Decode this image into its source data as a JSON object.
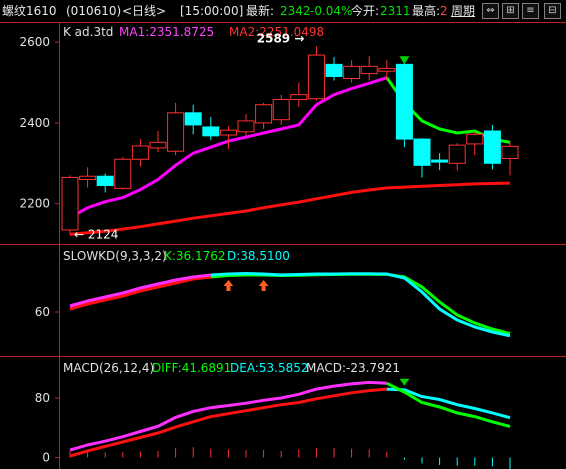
{
  "header": {
    "instrument": "螺纹1610",
    "code": "(010610)",
    "period": "<日线>",
    "time": "[15:00:00]",
    "latest_label": "最新:",
    "latest_value": "2342",
    "change_pct": "-0.04%",
    "open_label": "今开:",
    "open_value": "2311",
    "high_label": "最高:",
    "high_value": "2",
    "cycle_link": "周期",
    "buttons": [
      "⇔",
      "⊞",
      "≡",
      "⊟"
    ]
  },
  "colors": {
    "up": "#ff3030",
    "down": "#00ffff",
    "ma1_up": "#ff00ff",
    "ma1_down": "#00ff00",
    "ma2": "#ff1010",
    "k": "#ff30ff",
    "d": "#ff1010",
    "k_down": "#00ffff",
    "d_down": "#00ff00",
    "macd_bar": "#ff3030",
    "macd_bar_neg": "#00ffff",
    "axis": "#c02020"
  },
  "chart_data": [
    {
      "type": "candlestick",
      "title": "K  ad.3td",
      "legend": [
        {
          "name": "MA1",
          "label": "MA1:2351.8725"
        },
        {
          "name": "MA2",
          "label": "MA2:2251.0498"
        }
      ],
      "ylim": [
        2120,
        2640
      ],
      "yticks": [
        2200,
        2400,
        2600
      ],
      "annotations": [
        {
          "label": "2589",
          "value": 2589
        },
        {
          "label": "2124",
          "value": 2124
        }
      ],
      "candles": [
        {
          "o": 2135,
          "h": 2270,
          "l": 2124,
          "c": 2265
        },
        {
          "o": 2260,
          "h": 2290,
          "l": 2240,
          "c": 2268
        },
        {
          "o": 2268,
          "h": 2275,
          "l": 2228,
          "c": 2245
        },
        {
          "o": 2238,
          "h": 2315,
          "l": 2235,
          "c": 2310
        },
        {
          "o": 2310,
          "h": 2360,
          "l": 2292,
          "c": 2343
        },
        {
          "o": 2338,
          "h": 2380,
          "l": 2328,
          "c": 2352
        },
        {
          "o": 2330,
          "h": 2450,
          "l": 2320,
          "c": 2425
        },
        {
          "o": 2425,
          "h": 2445,
          "l": 2372,
          "c": 2395
        },
        {
          "o": 2390,
          "h": 2415,
          "l": 2357,
          "c": 2368
        },
        {
          "o": 2370,
          "h": 2392,
          "l": 2335,
          "c": 2382
        },
        {
          "o": 2378,
          "h": 2422,
          "l": 2368,
          "c": 2405
        },
        {
          "o": 2400,
          "h": 2450,
          "l": 2385,
          "c": 2445
        },
        {
          "o": 2408,
          "h": 2470,
          "l": 2395,
          "c": 2458
        },
        {
          "o": 2458,
          "h": 2500,
          "l": 2440,
          "c": 2470
        },
        {
          "o": 2460,
          "h": 2590,
          "l": 2455,
          "c": 2568
        },
        {
          "o": 2545,
          "h": 2563,
          "l": 2505,
          "c": 2515
        },
        {
          "o": 2510,
          "h": 2555,
          "l": 2500,
          "c": 2540
        },
        {
          "o": 2522,
          "h": 2565,
          "l": 2505,
          "c": 2540
        },
        {
          "o": 2528,
          "h": 2555,
          "l": 2505,
          "c": 2535
        },
        {
          "o": 2545,
          "h": 2555,
          "l": 2340,
          "c": 2360
        },
        {
          "o": 2360,
          "h": 2362,
          "l": 2265,
          "c": 2295
        },
        {
          "o": 2308,
          "h": 2325,
          "l": 2283,
          "c": 2303
        },
        {
          "o": 2300,
          "h": 2350,
          "l": 2282,
          "c": 2345
        },
        {
          "o": 2348,
          "h": 2378,
          "l": 2320,
          "c": 2372
        },
        {
          "o": 2380,
          "h": 2395,
          "l": 2285,
          "c": 2300
        },
        {
          "o": 2312,
          "h": 2352,
          "l": 2270,
          "c": 2342
        }
      ],
      "ma1": [
        2165,
        2190,
        2205,
        2215,
        2235,
        2260,
        2295,
        2325,
        2340,
        2355,
        2365,
        2375,
        2385,
        2395,
        2445,
        2470,
        2485,
        2498,
        2512,
        2450,
        2405,
        2385,
        2375,
        2380,
        2360,
        2352
      ],
      "ma2": [
        2124,
        2128,
        2132,
        2137,
        2143,
        2150,
        2157,
        2164,
        2170,
        2176,
        2182,
        2190,
        2197,
        2204,
        2212,
        2220,
        2228,
        2234,
        2239,
        2241,
        2243,
        2245,
        2247,
        2249,
        2250,
        2251
      ],
      "ma1_down_from": 18
    },
    {
      "type": "line",
      "title": "SLOWKD(9,3,3,2)",
      "legend": [
        {
          "name": "K",
          "label": "K:36.1762"
        },
        {
          "name": "D",
          "label": "D:38.5100"
        }
      ],
      "ylim": [
        20,
        110
      ],
      "yticks": [
        60
      ],
      "k": [
        66,
        71,
        75,
        79,
        84,
        88,
        92,
        95,
        97,
        98,
        98.5,
        98,
        97,
        97.5,
        98,
        98,
        98.3,
        98.2,
        98,
        94,
        80,
        63,
        52,
        45,
        40,
        36.2
      ],
      "d": [
        63,
        68,
        72,
        76,
        81,
        85,
        89,
        93,
        95,
        96.5,
        97,
        97,
        96.5,
        96.8,
        97.2,
        97.5,
        97.7,
        97.8,
        97.6,
        95,
        85,
        70,
        57,
        49,
        43,
        38.5
      ],
      "down_from": 8,
      "arrow_marks": [
        9,
        11
      ]
    },
    {
      "type": "line",
      "title": "MACD(26,12,4)",
      "legend": [
        {
          "name": "DIFF",
          "label": "DIFF:41.6891"
        },
        {
          "name": "DEA",
          "label": "DEA:53.5852"
        },
        {
          "name": "MACD",
          "label": "MACD:-23.7921"
        }
      ],
      "ylim": [
        -10,
        115
      ],
      "yticks": [
        0,
        80
      ],
      "diff": [
        10,
        17,
        22,
        28,
        35,
        42,
        54,
        62,
        67,
        70,
        73,
        77,
        80,
        85,
        92,
        96,
        99,
        101,
        100,
        88,
        74,
        68,
        60,
        55,
        48,
        41.7
      ],
      "dea": [
        2,
        9,
        15,
        21,
        27,
        33,
        41,
        48,
        55,
        59,
        63,
        67,
        71,
        74,
        79,
        83,
        87,
        90,
        92,
        91,
        82,
        78,
        71,
        66,
        60,
        53.6
      ],
      "macd": [
        8,
        8,
        7,
        7,
        8,
        9,
        13,
        14,
        12,
        11,
        10,
        10,
        9,
        11,
        13,
        13,
        12,
        11,
        8,
        -3,
        -8,
        -10,
        -11,
        -11,
        -12,
        -23.8
      ],
      "down_from": 18
    }
  ]
}
